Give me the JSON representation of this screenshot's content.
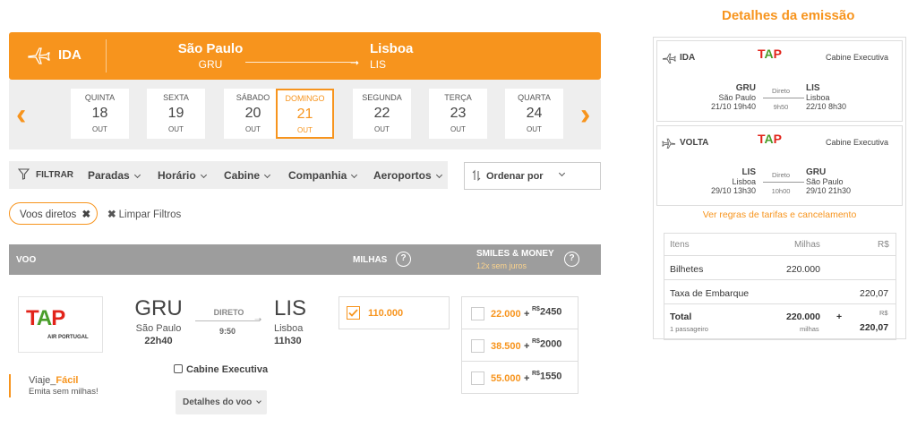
{
  "header": {
    "direction": "IDA",
    "origin_city": "São Paulo",
    "origin_code": "GRU",
    "dest_city": "Lisboa",
    "dest_code": "LIS"
  },
  "dates": [
    {
      "weekday": "QUINTA",
      "day": "18",
      "month": "OUT"
    },
    {
      "weekday": "SEXTA",
      "day": "19",
      "month": "OUT"
    },
    {
      "weekday": "SÁBADO",
      "day": "20",
      "month": "OUT"
    },
    {
      "weekday": "DOMINGO",
      "day": "21",
      "month": "OUT",
      "selected": true
    },
    {
      "weekday": "SEGUNDA",
      "day": "22",
      "month": "OUT"
    },
    {
      "weekday": "TERÇA",
      "day": "23",
      "month": "OUT"
    },
    {
      "weekday": "QUARTA",
      "day": "24",
      "month": "OUT"
    }
  ],
  "filters": {
    "label": "FILTRAR",
    "items": [
      "Paradas",
      "Horário",
      "Cabine",
      "Companhia",
      "Aeroportos"
    ],
    "sort_label": "Ordenar por"
  },
  "active_filter": "Voos diretos",
  "clear_filters": "Limpar Filtros",
  "table_header": {
    "voo": "VOO",
    "milhas": "MILHAS",
    "smiles_money": "SMILES & MONEY",
    "installments": "12x sem juros",
    "help": "?"
  },
  "flight": {
    "airline_logo_text": "TAP",
    "airline_sub": "AIR PORTUGAL",
    "origin_code": "GRU",
    "origin_city": "São Paulo",
    "depart_time": "22h40",
    "stop_type": "DIRETO",
    "duration": "9:50",
    "dest_code": "LIS",
    "dest_city": "Lisboa",
    "arrive_time": "11h30",
    "cabin": "Cabine Executiva",
    "details_button": "Detalhes do voo",
    "miles": "110.000",
    "smiles_money": [
      {
        "miles": "22.000",
        "currency": "R$",
        "cash": "2450"
      },
      {
        "miles": "38.500",
        "currency": "R$",
        "cash": "2000"
      },
      {
        "miles": "55.000",
        "currency": "R$",
        "cash": "1550"
      }
    ],
    "promo_title_a": "Viaje_",
    "promo_title_b": "Fácil",
    "promo_sub": "Emita sem milhas!"
  },
  "panel": {
    "title": "Detalhes da emissão",
    "outbound": {
      "label": "IDA",
      "cabin": "Cabine Executiva",
      "from_code": "GRU",
      "from_city": "São Paulo",
      "from_dt": "21/10 19h40",
      "stop": "Direto",
      "duration": "9h50",
      "to_code": "LIS",
      "to_city": "Lisboa",
      "to_dt": "22/10 8h30"
    },
    "inbound": {
      "label": "VOLTA",
      "cabin": "Cabine Executiva",
      "from_code": "LIS",
      "from_city": "Lisboa",
      "from_dt": "29/10 13h30",
      "stop": "Direto",
      "duration": "10h00",
      "to_code": "GRU",
      "to_city": "São Paulo",
      "to_dt": "29/10 21h30"
    },
    "rules_link": "Ver regras de tarifas e cancelamento",
    "cols": {
      "items": "Itens",
      "miles": "Milhas",
      "money": "R$"
    },
    "rows": [
      {
        "label": "Bilhetes",
        "miles": "220.000",
        "money": ""
      },
      {
        "label": "Taxa de Embarque",
        "miles": "",
        "money": "220,07"
      }
    ],
    "total": {
      "label": "Total",
      "sub": "1 passageiro",
      "miles": "220.000",
      "miles_unit": "milhas",
      "plus": "+",
      "currency": "R$",
      "money": "220,07"
    }
  },
  "colors": {
    "accent": "#f7941d",
    "header_gray": "#9d9d9d"
  }
}
